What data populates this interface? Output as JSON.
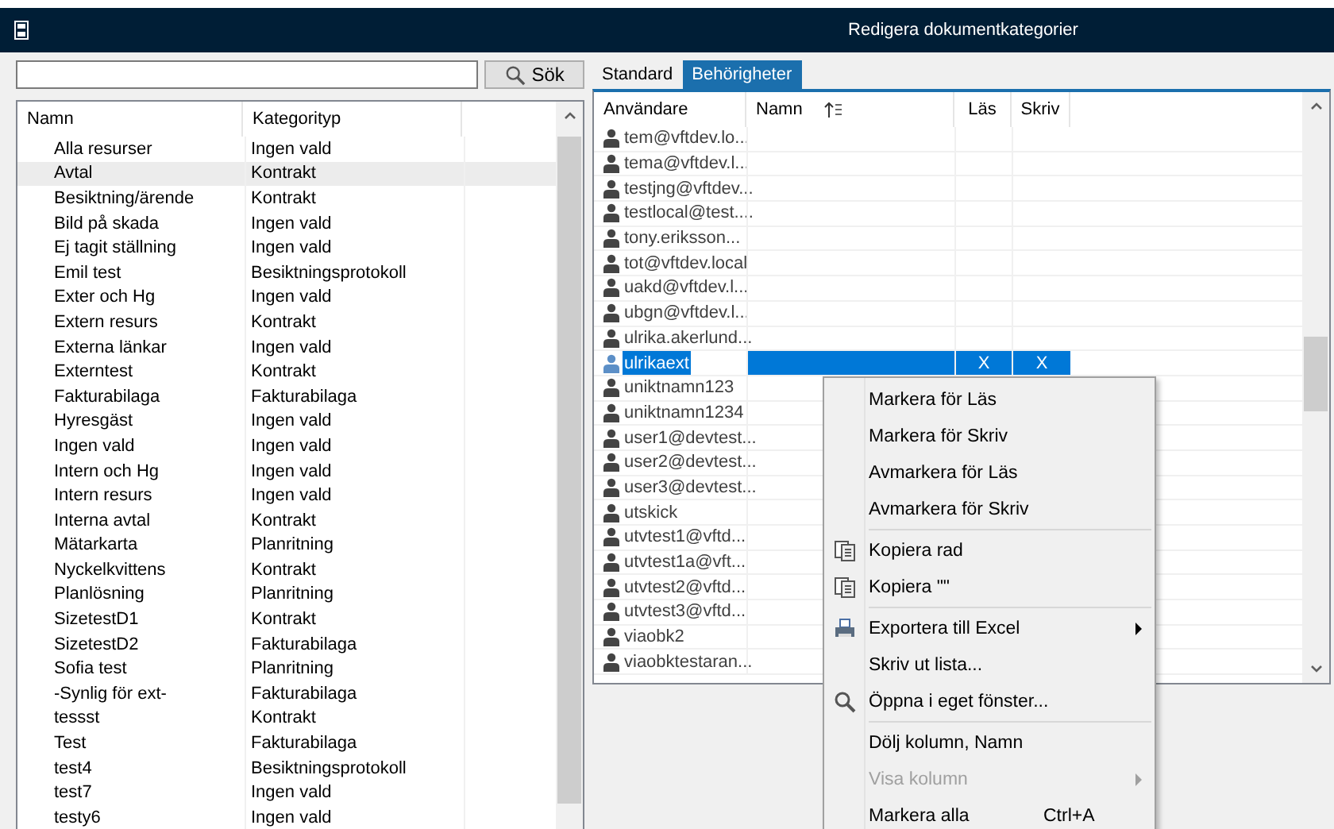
{
  "window": {
    "title": "Redigera dokumentkategorier"
  },
  "search": {
    "button": "Sök"
  },
  "categories": {
    "columns": [
      "Namn",
      "Kategorityp"
    ],
    "rows": [
      {
        "name": "Alla resurser",
        "type": "Ingen vald",
        "selected": false
      },
      {
        "name": "Avtal",
        "type": "Kontrakt",
        "selected": true
      },
      {
        "name": "Besiktning/ärende",
        "type": "Kontrakt",
        "selected": false
      },
      {
        "name": "Bild på skada",
        "type": "Ingen vald",
        "selected": false
      },
      {
        "name": "Ej tagit ställning",
        "type": "Ingen vald",
        "selected": false
      },
      {
        "name": "Emil test",
        "type": "Besiktningsprotokoll",
        "selected": false
      },
      {
        "name": "Exter och Hg",
        "type": "Ingen vald",
        "selected": false
      },
      {
        "name": "Extern resurs",
        "type": "Kontrakt",
        "selected": false
      },
      {
        "name": "Externa länkar",
        "type": "Ingen vald",
        "selected": false
      },
      {
        "name": "Externtest",
        "type": "Kontrakt",
        "selected": false
      },
      {
        "name": "Fakturabilaga",
        "type": "Fakturabilaga",
        "selected": false
      },
      {
        "name": "Hyresgäst",
        "type": "Ingen vald",
        "selected": false
      },
      {
        "name": "Ingen vald",
        "type": "Ingen vald",
        "selected": false
      },
      {
        "name": "Intern och Hg",
        "type": "Ingen vald",
        "selected": false
      },
      {
        "name": "Intern resurs",
        "type": "Ingen vald",
        "selected": false
      },
      {
        "name": "Interna avtal",
        "type": "Kontrakt",
        "selected": false
      },
      {
        "name": "Mätarkarta",
        "type": "Planritning",
        "selected": false
      },
      {
        "name": "Nyckelkvittens",
        "type": "Kontrakt",
        "selected": false
      },
      {
        "name": "Planlösning",
        "type": "Planritning",
        "selected": false
      },
      {
        "name": "SizetestD1",
        "type": "Kontrakt",
        "selected": false
      },
      {
        "name": "SizetestD2",
        "type": "Fakturabilaga",
        "selected": false
      },
      {
        "name": "Sofia test",
        "type": "Planritning",
        "selected": false
      },
      {
        "name": "-Synlig för ext-",
        "type": "Fakturabilaga",
        "selected": false
      },
      {
        "name": "tessst",
        "type": "Kontrakt",
        "selected": false
      },
      {
        "name": "Test",
        "type": "Fakturabilaga",
        "selected": false
      },
      {
        "name": "test4",
        "type": "Besiktningsprotokoll",
        "selected": false
      },
      {
        "name": "test7",
        "type": "Ingen vald",
        "selected": false
      },
      {
        "name": "testy6",
        "type": "Ingen vald",
        "selected": false
      }
    ]
  },
  "tabs": [
    {
      "label": "Standard",
      "selected": false
    },
    {
      "label": "Behörigheter",
      "selected": true
    }
  ],
  "permissions": {
    "columns": [
      "Användare",
      "Namn",
      "Läs",
      "Skriv"
    ],
    "rows": [
      {
        "user": "tem@vftdev.lo...",
        "selected": false
      },
      {
        "user": "tema@vftdev.l...",
        "selected": false
      },
      {
        "user": "testjng@vftdev...",
        "selected": false
      },
      {
        "user": "testlocal@test....",
        "selected": false
      },
      {
        "user": "tony.eriksson...",
        "selected": false
      },
      {
        "user": "tot@vftdev.local",
        "selected": false
      },
      {
        "user": "uakd@vftdev.l...",
        "selected": false
      },
      {
        "user": "ubgn@vftdev.l...",
        "selected": false
      },
      {
        "user": "ulrika.akerlund...",
        "selected": false
      },
      {
        "user": "ulrikaext",
        "read": "X",
        "write": "X",
        "selected": true
      },
      {
        "user": "uniktnamn123",
        "selected": false
      },
      {
        "user": "uniktnamn1234",
        "selected": false
      },
      {
        "user": "user1@devtest...",
        "selected": false
      },
      {
        "user": "user2@devtest...",
        "selected": false
      },
      {
        "user": "user3@devtest...",
        "selected": false
      },
      {
        "user": "utskick",
        "selected": false
      },
      {
        "user": "utvtest1@vftd...",
        "selected": false
      },
      {
        "user": "utvtest1a@vft...",
        "selected": false
      },
      {
        "user": "utvtest2@vftd...",
        "selected": false
      },
      {
        "user": "utvtest3@vftd...",
        "selected": false
      },
      {
        "user": "viaobk2",
        "selected": false
      },
      {
        "user": "viaobktestaran...",
        "selected": false
      }
    ]
  },
  "context_menu": [
    {
      "kind": "item",
      "label": "Markera för Läs",
      "disabled": false
    },
    {
      "kind": "item",
      "label": "Markera för Skriv",
      "disabled": false
    },
    {
      "kind": "item",
      "label": "Avmarkera för Läs",
      "disabled": false
    },
    {
      "kind": "item",
      "label": "Avmarkera för Skriv",
      "disabled": false
    },
    {
      "kind": "separator"
    },
    {
      "kind": "copy",
      "label": "Kopiera rad",
      "disabled": false
    },
    {
      "kind": "copy",
      "label": "Kopiera \"\"",
      "disabled": false
    },
    {
      "kind": "separator"
    },
    {
      "kind": "export",
      "label": "Exportera till Excel",
      "submenu": true,
      "disabled": false
    },
    {
      "kind": "item",
      "label": "Skriv ut lista...",
      "disabled": false
    },
    {
      "kind": "open",
      "label": "Öppna i eget fönster...",
      "disabled": false
    },
    {
      "kind": "separator"
    },
    {
      "kind": "item",
      "label": "Dölj kolumn, Namn",
      "disabled": false
    },
    {
      "kind": "item",
      "label": "Visa kolumn",
      "submenu": true,
      "disabled": true
    },
    {
      "kind": "item",
      "label": "Markera alla",
      "shortcut": "Ctrl+A",
      "disabled": false
    }
  ]
}
